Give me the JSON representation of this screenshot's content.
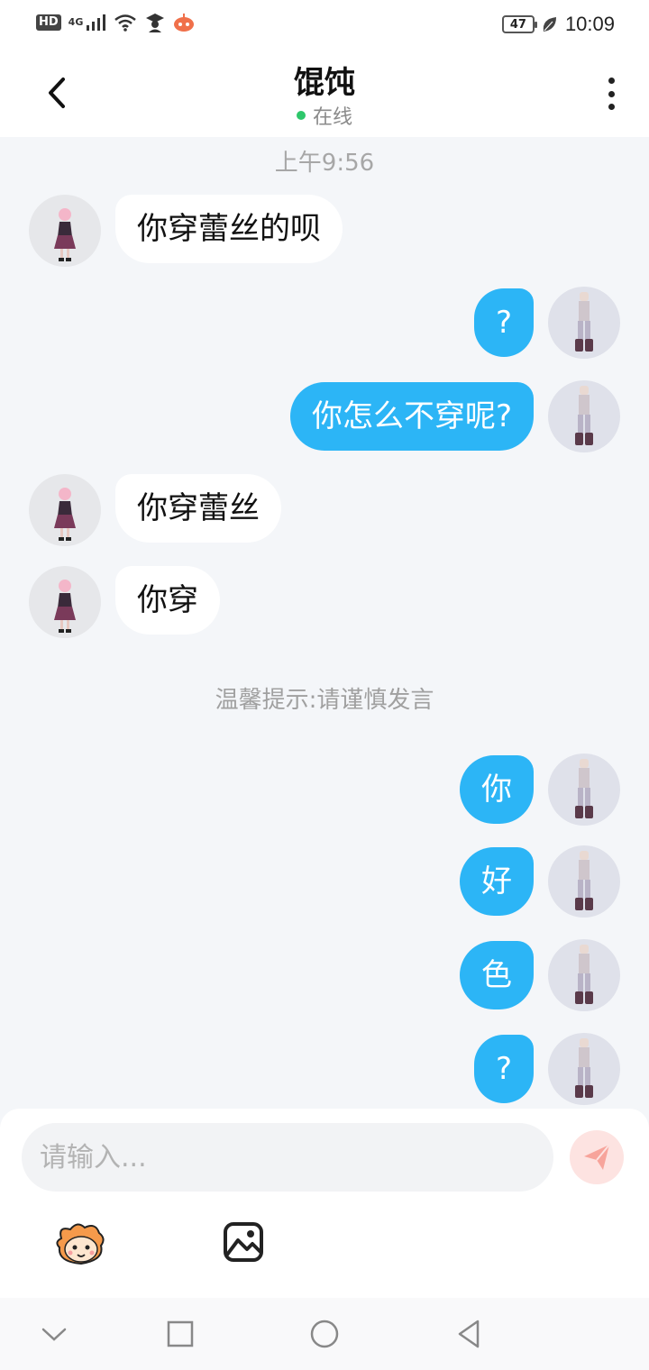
{
  "status_bar": {
    "left_icons": [
      "hd-icon",
      "signal-4g-icon",
      "wifi-icon",
      "graduate-icon",
      "app-icon"
    ],
    "hd_label": "HD",
    "network_label": "4G",
    "battery": "47",
    "time": "10:09"
  },
  "header": {
    "title": "馄饨",
    "status": "在线",
    "status_color": "#2ec76b"
  },
  "chat": {
    "time_divider": "上午9:56",
    "tip": "温馨提示:请谨慎发言",
    "messages": [
      {
        "side": "in",
        "text": "你穿蕾丝的呗"
      },
      {
        "side": "out",
        "text": "?"
      },
      {
        "side": "out",
        "text": "你怎么不穿呢?"
      },
      {
        "side": "in",
        "text": "你穿蕾丝"
      },
      {
        "side": "in",
        "text": "你穿"
      },
      {
        "side": "out",
        "text": "你"
      },
      {
        "side": "out",
        "text": "好"
      },
      {
        "side": "out",
        "text": "色"
      },
      {
        "side": "out",
        "text": "?"
      }
    ]
  },
  "composer": {
    "placeholder": "请输入...",
    "value": ""
  },
  "colors": {
    "outgoing_bubble": "#2cb5f6",
    "incoming_bubble": "#ffffff",
    "background": "#f4f6f9"
  }
}
